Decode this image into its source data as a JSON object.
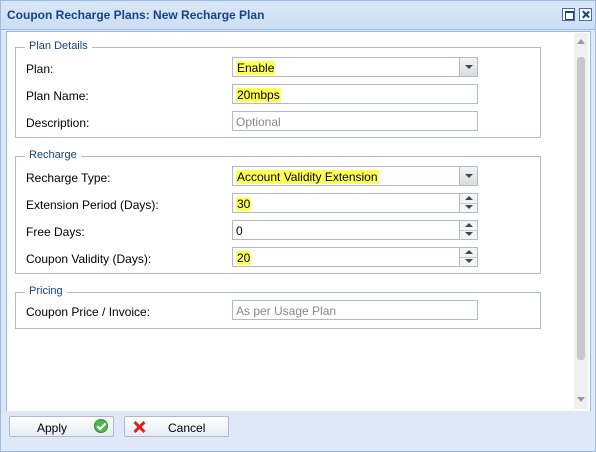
{
  "window": {
    "title": "Coupon Recharge Plans: New Recharge Plan"
  },
  "plan_details": {
    "legend": "Plan Details",
    "plan_label": "Plan:",
    "plan_value": "Enable",
    "plan_name_label": "Plan Name:",
    "plan_name_value": "20mbps",
    "description_label": "Description:",
    "description_placeholder": "Optional"
  },
  "recharge": {
    "legend": "Recharge",
    "type_label": "Recharge Type:",
    "type_value": "Account Validity Extension",
    "extension_label": "Extension Period (Days):",
    "extension_value": "30",
    "free_days_label": "Free Days:",
    "free_days_value": "0",
    "coupon_validity_label": "Coupon Validity (Days):",
    "coupon_validity_value": "20"
  },
  "pricing": {
    "legend": "Pricing",
    "price_label": "Coupon Price / Invoice:",
    "price_placeholder": "As per Usage Plan"
  },
  "footer": {
    "apply_label": "Apply",
    "cancel_label": "Cancel"
  },
  "colors": {
    "highlight": "#ffff55",
    "title_text": "#15428b",
    "legend_text": "#15428b"
  }
}
